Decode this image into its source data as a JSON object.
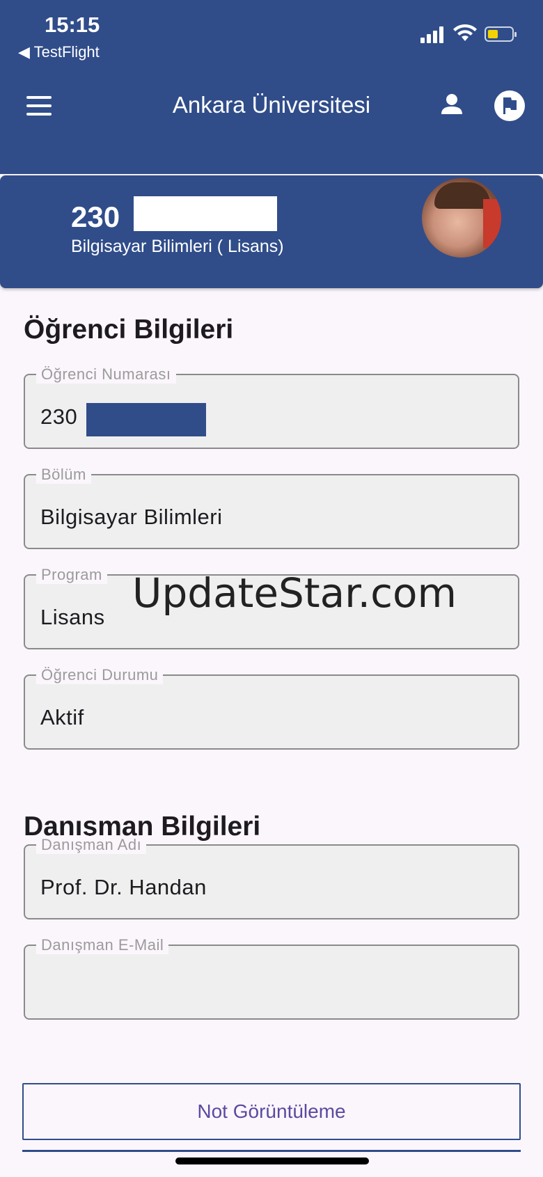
{
  "status_bar": {
    "time": "15:15",
    "back_app": "◀ TestFlight"
  },
  "app_bar": {
    "title": "Ankara Üniversitesi"
  },
  "profile": {
    "student_number": "230",
    "program": "Bilgisayar Bilimleri ( Lisans)"
  },
  "sections": {
    "student_info": "Öğrenci Bilgileri",
    "advisor_info": "Danışman Bilgileri"
  },
  "fields": {
    "student_number": {
      "label": "Öğrenci Numarası",
      "value": "230"
    },
    "department": {
      "label": "Bölüm",
      "value": "Bilgisayar Bilimleri"
    },
    "program": {
      "label": "Program",
      "value": "Lisans"
    },
    "status": {
      "label": "Öğrenci Durumu",
      "value": "Aktif"
    },
    "advisor_name": {
      "label": "Danışman Adı",
      "value": "Prof. Dr. Handan"
    },
    "advisor_email": {
      "label": "Danışman E-Mail",
      "value": ""
    }
  },
  "watermark": "UpdateStar.com",
  "buttons": {
    "grades": "Not Görüntüleme"
  },
  "colors": {
    "primary": "#304d8a",
    "background": "#fbf6fc",
    "battery": "#f5d300"
  }
}
